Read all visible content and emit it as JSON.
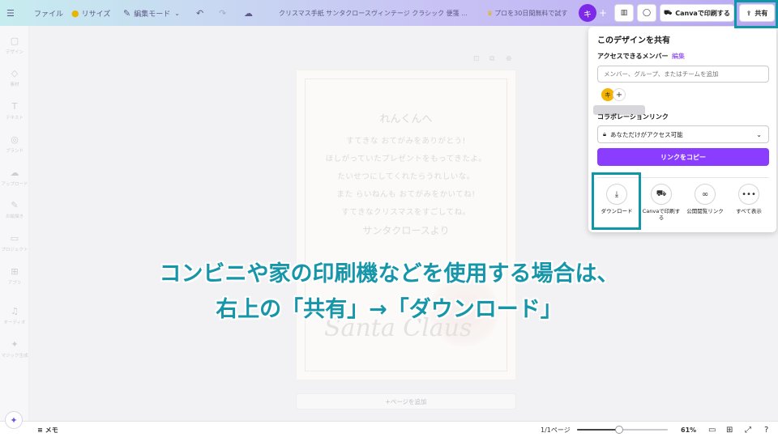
{
  "topbar": {
    "file_menu": "ファイル",
    "resize": "リサイズ",
    "edit_mode": "編集モード",
    "doc_title": "クリスマス手紙 サンタクロースヴィンテージ クラシック 便箋 ...",
    "pro_trial": "プロを30日間無料で試す",
    "avatar_initial": "キ",
    "add": "+",
    "print_button": "Canvaで印刷する",
    "share_button": "共有"
  },
  "sidebar": {
    "items": [
      {
        "label": "デザイン",
        "icon": "▢"
      },
      {
        "label": "素材",
        "icon": "◇"
      },
      {
        "label": "テキスト",
        "icon": "T"
      },
      {
        "label": "ブランド",
        "icon": "◎"
      },
      {
        "label": "アップロード",
        "icon": "☁"
      },
      {
        "label": "お絵描き",
        "icon": "✎"
      },
      {
        "label": "プロジェクト",
        "icon": "▭"
      },
      {
        "label": "アプリ",
        "icon": "⊞"
      },
      {
        "label": "オーディオ",
        "icon": "♫"
      },
      {
        "label": "マジック生成",
        "icon": "✦"
      }
    ]
  },
  "design": {
    "title": "れんくんへ",
    "lines": [
      "すてきな おてがみをありがとう!",
      "ほしがっていたプレゼントをもってきたよ。",
      "たいせつにしてくれたらうれしいな。",
      "また らいねんも おてがみをかいてね!",
      "すてきなクリスマスをすごしてね。"
    ],
    "from": "サンタクロースより",
    "signature": "Santa Claus",
    "add_page": "+ページを追加"
  },
  "share_panel": {
    "title": "このデザインを共有",
    "access_label": "アクセスできるメンバー",
    "edit_link": "編集",
    "search_placeholder": "メンバー、グループ、またはチームを追加",
    "member_initial": "キ",
    "add_member": "+",
    "collab_label": "コラボレーションリンク",
    "access_option": "あなただけがアクセス可能",
    "copy_button": "リンクをコピー",
    "actions": [
      {
        "label": "ダウンロード",
        "icon": "download-icon"
      },
      {
        "label": "Canvaで印刷す\nる",
        "icon": "truck-icon"
      },
      {
        "label": "公開閲覧リンク",
        "icon": "link-icon"
      },
      {
        "label": "すべて表示",
        "icon": "more-icon"
      }
    ]
  },
  "bottombar": {
    "notes": "メモ",
    "page_indicator": "1/1ページ",
    "zoom": "61%",
    "zoom_level": 0.46
  },
  "caption": {
    "line1": "コンビニや家の印刷機などを使用する場合は、",
    "line2": "右上の「共有」→「ダウンロード」"
  },
  "colors": {
    "highlight": "#0f97a7",
    "brand_purple": "#8b3dff",
    "caption": "#1696a8"
  }
}
